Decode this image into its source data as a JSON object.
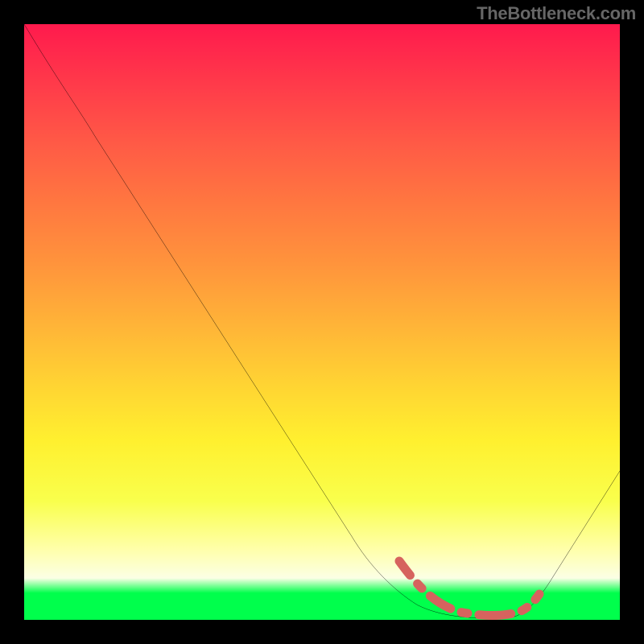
{
  "attribution": "TheBottleneck.com",
  "chart_data": {
    "type": "line",
    "title": "",
    "xlabel": "",
    "ylabel": "",
    "xlim": [
      0,
      100
    ],
    "ylim": [
      0,
      100
    ],
    "grid": false,
    "legend": false,
    "series": [
      {
        "name": "bottleneck-curve",
        "color": "#000000",
        "x": [
          0,
          10,
          20,
          30,
          40,
          50,
          60,
          65,
          70,
          73,
          78,
          82,
          85,
          90,
          95,
          100
        ],
        "y": [
          100,
          88,
          73,
          58,
          44,
          30,
          16,
          10,
          4,
          1,
          0,
          0,
          2,
          8,
          16,
          25
        ]
      },
      {
        "name": "optimal-range-marker",
        "color": "#d6635e",
        "x": [
          64,
          67,
          70,
          73,
          76,
          79,
          82,
          85
        ],
        "y": [
          10,
          6,
          3,
          1,
          0,
          0,
          0,
          2
        ]
      }
    ],
    "background_gradient_stops": [
      {
        "pos": 0,
        "color": "#ff1a4d"
      },
      {
        "pos": 0.5,
        "color": "#ffb238"
      },
      {
        "pos": 0.8,
        "color": "#f9ff4c"
      },
      {
        "pos": 0.95,
        "color": "#00ff4c"
      },
      {
        "pos": 1.0,
        "color": "#00ff4c"
      }
    ]
  }
}
